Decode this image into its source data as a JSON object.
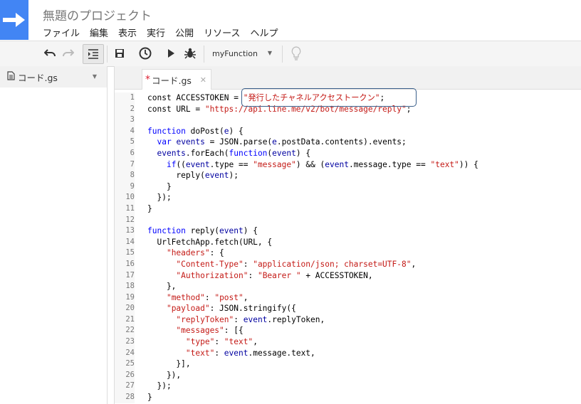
{
  "app": {
    "title": "無題のプロジェクト"
  },
  "menu": [
    "ファイル",
    "編集",
    "表示",
    "実行",
    "公開",
    "リソース",
    "ヘルプ"
  ],
  "toolbar": {
    "function_name": "myFunction"
  },
  "sidebar": {
    "file_name": "コード.gs"
  },
  "tab": {
    "label": "コード.gs"
  },
  "code": {
    "line_numbers": [
      "1",
      "2",
      "3",
      "4",
      "5",
      "6",
      "7",
      "8",
      "9",
      "10",
      "11",
      "12",
      "13",
      "14",
      "15",
      "16",
      "17",
      "18",
      "19",
      "20",
      "21",
      "22",
      "23",
      "24",
      "25",
      "26",
      "27",
      "28"
    ],
    "lines": [
      [
        [
          "",
          "const ACCESSTOKEN = "
        ],
        [
          "str",
          "\"発行したチャネルアクセストークン\""
        ],
        [
          "",
          ";"
        ]
      ],
      [
        [
          "",
          "const URL = "
        ],
        [
          "str",
          "\"https://api.line.me/v2/bot/message/reply\""
        ],
        [
          "",
          ";"
        ]
      ],
      [
        [
          "",
          ""
        ]
      ],
      [
        [
          "kw",
          "function"
        ],
        [
          "",
          " doPost("
        ],
        [
          "var",
          "e"
        ],
        [
          "",
          ") {"
        ]
      ],
      [
        [
          "",
          "  "
        ],
        [
          "kw",
          "var"
        ],
        [
          "",
          " "
        ],
        [
          "var",
          "events"
        ],
        [
          "",
          " = JSON.parse("
        ],
        [
          "var",
          "e"
        ],
        [
          "",
          ".postData.contents).events;"
        ]
      ],
      [
        [
          "",
          "  "
        ],
        [
          "var",
          "events"
        ],
        [
          "",
          ".forEach("
        ],
        [
          "kw",
          "function"
        ],
        [
          "",
          "("
        ],
        [
          "var",
          "event"
        ],
        [
          "",
          ") {"
        ]
      ],
      [
        [
          "",
          "    "
        ],
        [
          "kw",
          "if"
        ],
        [
          "",
          "(("
        ],
        [
          "var",
          "event"
        ],
        [
          "",
          ".type == "
        ],
        [
          "str",
          "\"message\""
        ],
        [
          "",
          ") && ("
        ],
        [
          "var",
          "event"
        ],
        [
          "",
          ".message.type == "
        ],
        [
          "str",
          "\"text\""
        ],
        [
          "",
          ")) {"
        ]
      ],
      [
        [
          "",
          "      reply("
        ],
        [
          "var",
          "event"
        ],
        [
          "",
          ");"
        ]
      ],
      [
        [
          "",
          "    }"
        ]
      ],
      [
        [
          "",
          "  });"
        ]
      ],
      [
        [
          "",
          "}"
        ]
      ],
      [
        [
          "",
          ""
        ]
      ],
      [
        [
          "kw",
          "function"
        ],
        [
          "",
          " reply("
        ],
        [
          "var",
          "event"
        ],
        [
          "",
          ") {"
        ]
      ],
      [
        [
          "",
          "  UrlFetchApp.fetch(URL, {"
        ]
      ],
      [
        [
          "",
          "    "
        ],
        [
          "str",
          "\"headers\""
        ],
        [
          "",
          ": {"
        ]
      ],
      [
        [
          "",
          "      "
        ],
        [
          "str",
          "\"Content-Type\""
        ],
        [
          "",
          ": "
        ],
        [
          "str",
          "\"application/json; charset=UTF-8\""
        ],
        [
          "",
          ","
        ]
      ],
      [
        [
          "",
          "      "
        ],
        [
          "str",
          "\"Authorization\""
        ],
        [
          "",
          ": "
        ],
        [
          "str",
          "\"Bearer \""
        ],
        [
          "",
          " + ACCESSTOKEN,"
        ]
      ],
      [
        [
          "",
          "    },"
        ]
      ],
      [
        [
          "",
          "    "
        ],
        [
          "str",
          "\"method\""
        ],
        [
          "",
          ": "
        ],
        [
          "str",
          "\"post\""
        ],
        [
          "",
          ","
        ]
      ],
      [
        [
          "",
          "    "
        ],
        [
          "str",
          "\"payload\""
        ],
        [
          "",
          ": JSON.stringify({"
        ]
      ],
      [
        [
          "",
          "      "
        ],
        [
          "str",
          "\"replyToken\""
        ],
        [
          "",
          ": "
        ],
        [
          "var",
          "event"
        ],
        [
          "",
          ".replyToken,"
        ]
      ],
      [
        [
          "",
          "      "
        ],
        [
          "str",
          "\"messages\""
        ],
        [
          "",
          ": [{"
        ]
      ],
      [
        [
          "",
          "        "
        ],
        [
          "str",
          "\"type\""
        ],
        [
          "",
          ": "
        ],
        [
          "str",
          "\"text\""
        ],
        [
          "",
          ","
        ]
      ],
      [
        [
          "",
          "        "
        ],
        [
          "str",
          "\"text\""
        ],
        [
          "",
          ": "
        ],
        [
          "var",
          "event"
        ],
        [
          "",
          ".message.text,"
        ]
      ],
      [
        [
          "",
          "      }],"
        ]
      ],
      [
        [
          "",
          "    }),"
        ]
      ],
      [
        [
          "",
          "  });"
        ]
      ],
      [
        [
          "",
          "}"
        ]
      ]
    ]
  }
}
